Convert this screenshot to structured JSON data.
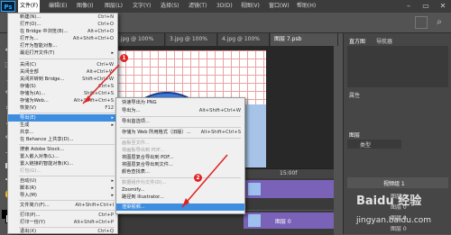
{
  "app": {
    "logo": "Ps",
    "menubar": [
      "文件(F)",
      "编辑(E)",
      "图像(I)",
      "图层(L)",
      "文字(Y)",
      "选择(S)",
      "滤镜(T)",
      "3D(D)",
      "视图(V)",
      "窗口(W)",
      "帮助(H)"
    ]
  },
  "doc_tabs": [
    ".jpg @ 100%",
    "3.jpg @ 100%",
    "4.jpg @ 100%",
    "图层 7.psb"
  ],
  "timeline": {
    "time_mark": "15:00f",
    "layer_label": "图层 0",
    "layer_label_2": "图层 0"
  },
  "file_menu": {
    "items": [
      {
        "label": "新建(N)...",
        "shortcut": "Ctrl+N"
      },
      {
        "label": "打开(O)...",
        "shortcut": "Ctrl+O"
      },
      {
        "label": "在 Bridge 中浏览(B)...",
        "shortcut": "Alt+Ctrl+O"
      },
      {
        "label": "打开为...",
        "shortcut": "Alt+Shift+Ctrl+O"
      },
      {
        "label": "打开为智能对象...",
        "shortcut": ""
      },
      {
        "label": "最近打开文件(T)",
        "shortcut": ""
      },
      {
        "label": "关闭(C)",
        "shortcut": "Ctrl+W"
      },
      {
        "label": "关闭全部",
        "shortcut": "Alt+Ctrl+W"
      },
      {
        "label": "关闭并转到 Bridge...",
        "shortcut": "Shift+Ctrl+W"
      },
      {
        "label": "存储(S)",
        "shortcut": "Ctrl+S"
      },
      {
        "label": "存储为(A)...",
        "shortcut": "Shift+Ctrl+S"
      },
      {
        "label": "存储为Web...",
        "shortcut": "Alt+Shift+Ctrl+S"
      },
      {
        "label": "恢复(V)",
        "shortcut": "F12"
      },
      {
        "label": "导出(E)",
        "shortcut": ""
      },
      {
        "label": "生成",
        "shortcut": ""
      },
      {
        "label": "共享...",
        "shortcut": ""
      },
      {
        "label": "在 Behance 上共享(D)...",
        "shortcut": ""
      },
      {
        "label": "搜索 Adobe Stock...",
        "shortcut": ""
      },
      {
        "label": "置入嵌入对象(L)...",
        "shortcut": ""
      },
      {
        "label": "置入链接的智能对象(K)...",
        "shortcut": ""
      },
      {
        "label": "打包(G)...",
        "shortcut": ""
      },
      {
        "label": "自动(U)",
        "shortcut": ""
      },
      {
        "label": "脚本(R)",
        "shortcut": ""
      },
      {
        "label": "导入(M)",
        "shortcut": ""
      },
      {
        "label": "文件简介(F)...",
        "shortcut": "Alt+Shift+Ctrl+I"
      },
      {
        "label": "打印(P)...",
        "shortcut": "Ctrl+P"
      },
      {
        "label": "打印一份(Y)",
        "shortcut": "Alt+Shift+Ctrl+P"
      },
      {
        "label": "退出(X)",
        "shortcut": "Ctrl+Q"
      }
    ]
  },
  "export_submenu": {
    "items": [
      {
        "label": "快速导出为 PNG",
        "shortcut": ""
      },
      {
        "label": "导出为...",
        "shortcut": "Alt+Shift+Ctrl+W"
      },
      {
        "label": "导出首选项...",
        "shortcut": ""
      },
      {
        "label": "存储为 Web 所用格式（旧版）...",
        "shortcut": "Alt+Shift+Ctrl+S"
      },
      {
        "label": "画板至文件...",
        "shortcut": ""
      },
      {
        "label": "将画板导出到 PDF...",
        "shortcut": ""
      },
      {
        "label": "将图层复合导出到 PDF...",
        "shortcut": ""
      },
      {
        "label": "将图层复合导出到文件...",
        "shortcut": ""
      },
      {
        "label": "颜色查找表...",
        "shortcut": ""
      },
      {
        "label": "数据组作为文件(D)...",
        "shortcut": ""
      },
      {
        "label": "Zoomify...",
        "shortcut": ""
      },
      {
        "label": "路径到 Illustrator...",
        "shortcut": ""
      },
      {
        "label": "渲染视频...",
        "shortcut": ""
      }
    ]
  },
  "right_panel": {
    "tabs": [
      "直方图",
      "导航器"
    ],
    "props_label": "属性",
    "layers_tab": "图层",
    "filter_kind": "类型",
    "layer_group": "视频组 1",
    "layer_items": [
      "图层 0",
      "图层 0",
      "图层 0",
      "图层 0"
    ]
  },
  "annotations": {
    "step1": "1",
    "step2": "2"
  },
  "watermark": {
    "brand": "Baidu 经验",
    "url": "jingyan.baidu.com"
  }
}
